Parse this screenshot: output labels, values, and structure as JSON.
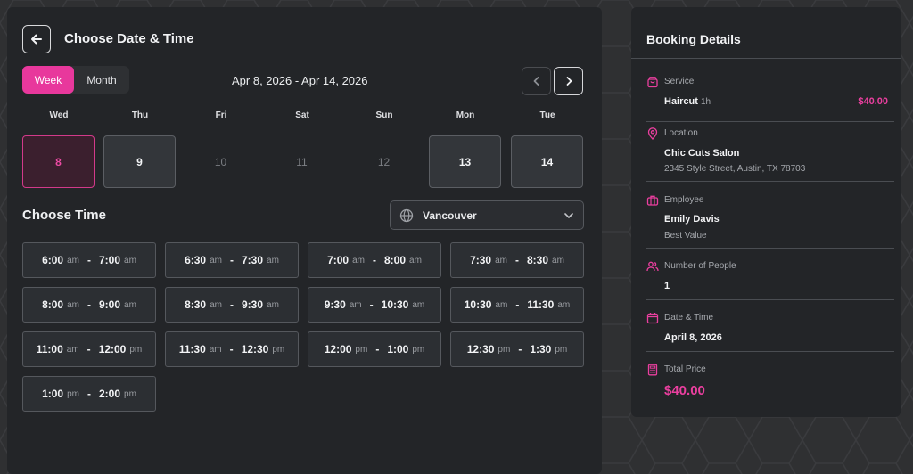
{
  "colors": {
    "accent": "#e8389c",
    "panel": "#232528",
    "background": "#2f3032"
  },
  "header": {
    "title": "Choose Date & Time",
    "back_icon": "arrow-left-icon"
  },
  "view_toggle": {
    "week": "Week",
    "month": "Month",
    "active": "Week"
  },
  "date_range": "Apr 8, 2026 - Apr 14, 2026",
  "week": [
    {
      "dow": "Wed",
      "num": "8",
      "state": "selected"
    },
    {
      "dow": "Thu",
      "num": "9",
      "state": "available"
    },
    {
      "dow": "Fri",
      "num": "10",
      "state": "unavailable"
    },
    {
      "dow": "Sat",
      "num": "11",
      "state": "unavailable"
    },
    {
      "dow": "Sun",
      "num": "12",
      "state": "unavailable"
    },
    {
      "dow": "Mon",
      "num": "13",
      "state": "available"
    },
    {
      "dow": "Tue",
      "num": "14",
      "state": "available"
    }
  ],
  "choose_time": "Choose Time",
  "timezone": {
    "value": "Vancouver",
    "icon": "globe-icon"
  },
  "slots": [
    {
      "start": "6:00",
      "start_ap": "am",
      "end": "7:00",
      "end_ap": "am"
    },
    {
      "start": "6:30",
      "start_ap": "am",
      "end": "7:30",
      "end_ap": "am"
    },
    {
      "start": "7:00",
      "start_ap": "am",
      "end": "8:00",
      "end_ap": "am"
    },
    {
      "start": "7:30",
      "start_ap": "am",
      "end": "8:30",
      "end_ap": "am"
    },
    {
      "start": "8:00",
      "start_ap": "am",
      "end": "9:00",
      "end_ap": "am"
    },
    {
      "start": "8:30",
      "start_ap": "am",
      "end": "9:30",
      "end_ap": "am"
    },
    {
      "start": "9:30",
      "start_ap": "am",
      "end": "10:30",
      "end_ap": "am"
    },
    {
      "start": "10:30",
      "start_ap": "am",
      "end": "11:30",
      "end_ap": "am"
    },
    {
      "start": "11:00",
      "start_ap": "am",
      "end": "12:00",
      "end_ap": "pm"
    },
    {
      "start": "11:30",
      "start_ap": "am",
      "end": "12:30",
      "end_ap": "pm"
    },
    {
      "start": "12:00",
      "start_ap": "pm",
      "end": "1:00",
      "end_ap": "pm"
    },
    {
      "start": "12:30",
      "start_ap": "pm",
      "end": "1:30",
      "end_ap": "pm"
    },
    {
      "start": "1:00",
      "start_ap": "pm",
      "end": "2:00",
      "end_ap": "pm"
    }
  ],
  "booking": {
    "title": "Booking Details",
    "service": {
      "label": "Service",
      "name": "Haircut",
      "duration": "1h",
      "price": "$40.00",
      "icon": "shopping-bag-icon"
    },
    "location": {
      "label": "Location",
      "name": "Chic Cuts Salon",
      "address": "2345 Style Street, Austin, TX 78703",
      "icon": "map-pin-icon"
    },
    "employee": {
      "label": "Employee",
      "name": "Emily Davis",
      "note": "Best Value",
      "icon": "briefcase-icon"
    },
    "people": {
      "label": "Number of People",
      "value": "1",
      "icon": "users-icon"
    },
    "datetime": {
      "label": "Date & Time",
      "value": "April 8, 2026",
      "icon": "calendar-icon"
    },
    "total": {
      "label": "Total Price",
      "value": "$40.00",
      "icon": "calculator-icon"
    }
  }
}
